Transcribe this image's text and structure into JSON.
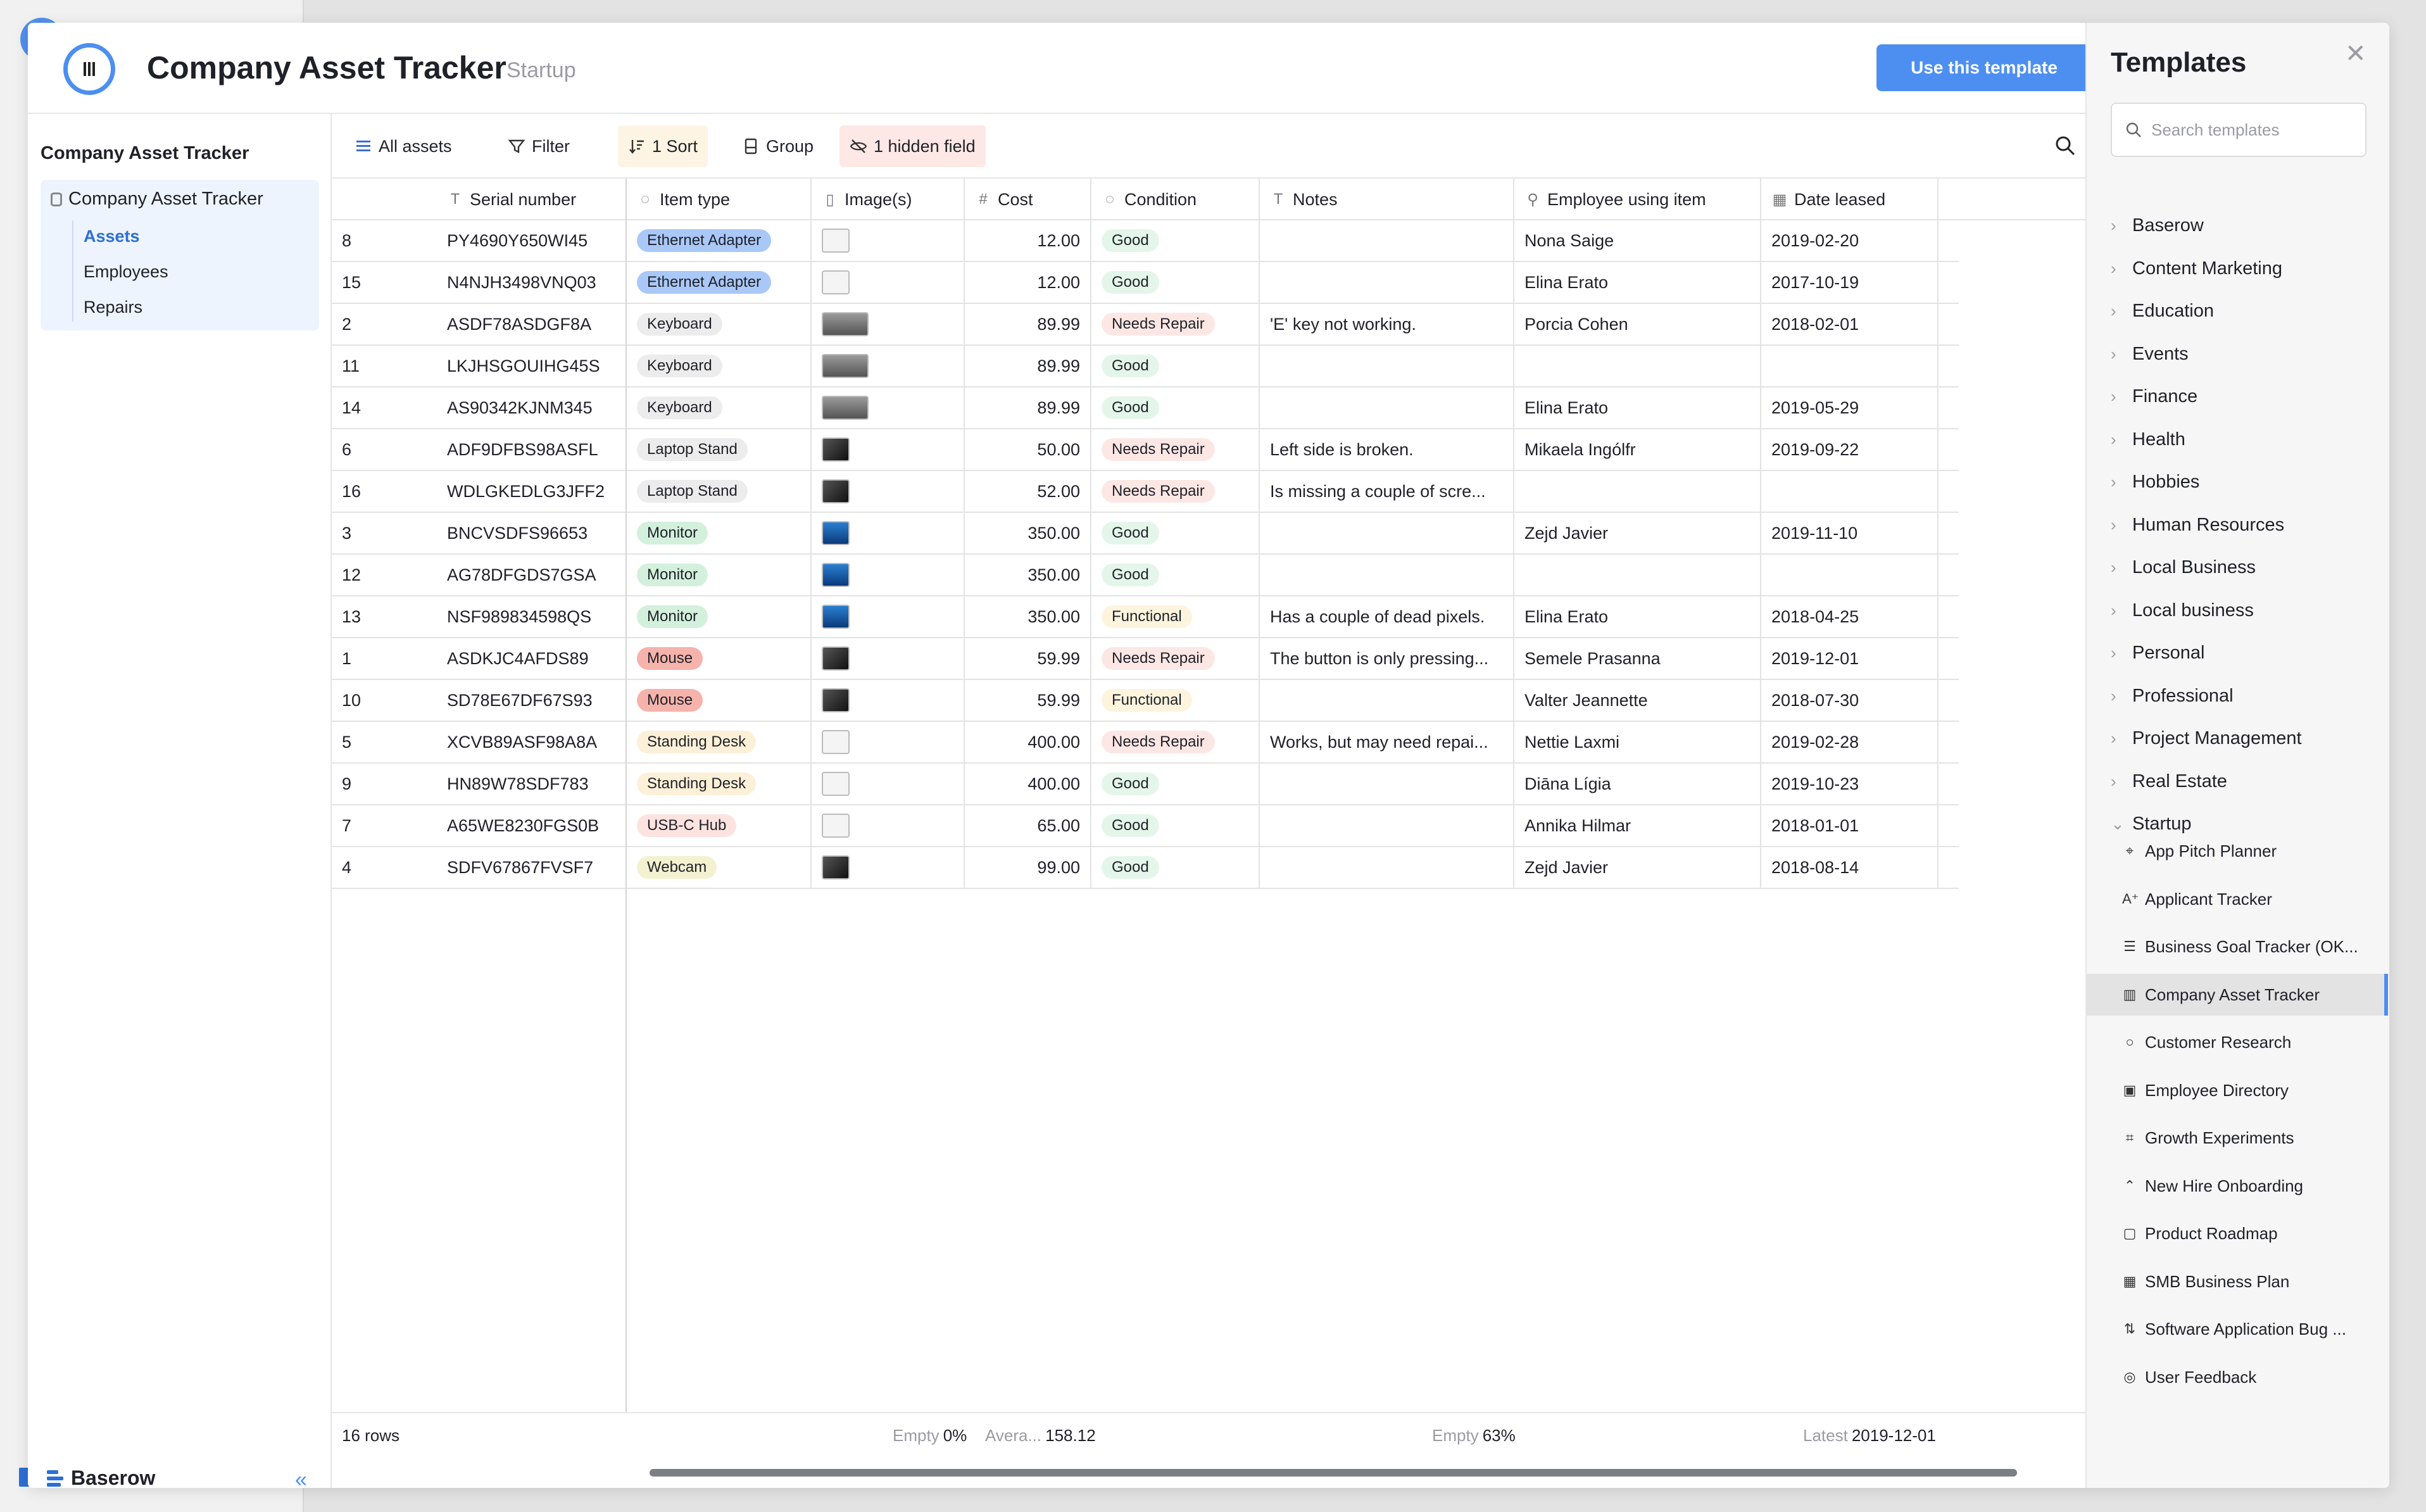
{
  "colors": {
    "accent": "#4d8ff0",
    "sort_bg": "#fdf4e3",
    "hidden_bg": "#fde8e6",
    "active_table": "#2c6fd6"
  },
  "header": {
    "title": "Company Asset Tracker",
    "category": "Startup",
    "use_button": "Use this template"
  },
  "sidebar": {
    "database_title": "Company Asset Tracker",
    "database_name": "Company Asset Tracker",
    "tables": [
      {
        "label": "Assets",
        "active": true
      },
      {
        "label": "Employees"
      },
      {
        "label": "Repairs"
      }
    ],
    "brand": "Baserow",
    "collapse_icon": "double-chevron-left-icon"
  },
  "toolbar": {
    "view": "All assets",
    "filter": "Filter",
    "sort": "1 Sort",
    "group": "Group",
    "hidden": "1 hidden field"
  },
  "columns": [
    "Serial number",
    "Item type",
    "Image(s)",
    "Cost",
    "Condition",
    "Notes",
    "Employee using item",
    "Date leased"
  ],
  "rows": [
    {
      "id": "8",
      "serial": "PY4690Y650WI45",
      "type": "Ethernet Adapter",
      "img": "light",
      "cost": "12.00",
      "cond": "Good",
      "notes": "",
      "emp": "Nona Saige",
      "date": "2019-02-20"
    },
    {
      "id": "15",
      "serial": "N4NJH3498VNQ03",
      "type": "Ethernet Adapter",
      "img": "light",
      "cost": "12.00",
      "cond": "Good",
      "notes": "",
      "emp": "Elina Erato",
      "date": "2017-10-19"
    },
    {
      "id": "2",
      "serial": "ASDF78ASDGF8A",
      "type": "Keyboard",
      "img": "wide",
      "cost": "89.99",
      "cond": "Needs Repair",
      "notes": "'E' key not working.",
      "emp": "Porcia Cohen",
      "date": "2018-02-01"
    },
    {
      "id": "11",
      "serial": "LKJHSGOUIHG45S",
      "type": "Keyboard",
      "img": "wide",
      "cost": "89.99",
      "cond": "Good",
      "notes": "",
      "emp": "",
      "date": ""
    },
    {
      "id": "14",
      "serial": "AS90342KJNM345",
      "type": "Keyboard",
      "img": "wide",
      "cost": "89.99",
      "cond": "Good",
      "notes": "",
      "emp": "Elina Erato",
      "date": "2019-05-29"
    },
    {
      "id": "6",
      "serial": "ADF9DFBS98ASFL",
      "type": "Laptop Stand",
      "img": "dark",
      "cost": "50.00",
      "cond": "Needs Repair",
      "notes": "Left side is broken.",
      "emp": "Mikaela Ingólfr",
      "date": "2019-09-22"
    },
    {
      "id": "16",
      "serial": "WDLGKEDLG3JFF2",
      "type": "Laptop Stand",
      "img": "dark",
      "cost": "52.00",
      "cond": "Needs Repair",
      "notes": "Is missing a couple of scre...",
      "emp": "",
      "date": ""
    },
    {
      "id": "3",
      "serial": "BNCVSDFS96653",
      "type": "Monitor",
      "img": "blue",
      "cost": "350.00",
      "cond": "Good",
      "notes": "",
      "emp": "Zejd Javier",
      "date": "2019-11-10"
    },
    {
      "id": "12",
      "serial": "AG78DFGDS7GSA",
      "type": "Monitor",
      "img": "blue",
      "cost": "350.00",
      "cond": "Good",
      "notes": "",
      "emp": "",
      "date": ""
    },
    {
      "id": "13",
      "serial": "NSF989834598QS",
      "type": "Monitor",
      "img": "blue",
      "cost": "350.00",
      "cond": "Functional",
      "notes": "Has a couple of dead pixels.",
      "emp": "Elina Erato",
      "date": "2018-04-25"
    },
    {
      "id": "1",
      "serial": "ASDKJC4AFDS89",
      "type": "Mouse",
      "img": "dark",
      "cost": "59.99",
      "cond": "Needs Repair",
      "notes": "The button is only pressing...",
      "emp": "Semele Prasanna",
      "date": "2019-12-01"
    },
    {
      "id": "10",
      "serial": "SD78E67DF67S93",
      "type": "Mouse",
      "img": "dark",
      "cost": "59.99",
      "cond": "Functional",
      "notes": "",
      "emp": "Valter Jeannette",
      "date": "2018-07-30"
    },
    {
      "id": "5",
      "serial": "XCVB89ASF98A8A",
      "type": "Standing Desk",
      "img": "light",
      "cost": "400.00",
      "cond": "Needs Repair",
      "notes": "Works, but may need repai...",
      "emp": "Nettie Laxmi",
      "date": "2019-02-28"
    },
    {
      "id": "9",
      "serial": "HN89W78SDF783",
      "type": "Standing Desk",
      "img": "light",
      "cost": "400.00",
      "cond": "Good",
      "notes": "",
      "emp": "Diāna Lígia",
      "date": "2019-10-23"
    },
    {
      "id": "7",
      "serial": "A65WE8230FGS0B",
      "type": "USB-C Hub",
      "img": "light",
      "cost": "65.00",
      "cond": "Good",
      "notes": "",
      "emp": "Annika Hilmar",
      "date": "2018-01-01"
    },
    {
      "id": "4",
      "serial": "SDFV67867FVSF7",
      "type": "Webcam",
      "img": "dark",
      "cost": "99.00",
      "cond": "Good",
      "notes": "",
      "emp": "Zejd Javier",
      "date": "2018-08-14"
    }
  ],
  "type_colors": {
    "Ethernet Adapter": "#a9c8f7",
    "Keyboard": "#ececec",
    "Laptop Stand": "#ececec",
    "Monitor": "#d3f0dc",
    "Mouse": "#f5b3ab",
    "Standing Desk": "#fdf0d8",
    "USB-C Hub": "#fde3e0",
    "Webcam": "#f3f1d0"
  },
  "cond_colors": {
    "Good": "#e4f6ea",
    "Needs Repair": "#fde7e5",
    "Functional": "#fdf4de"
  },
  "footer": {
    "row_count": "16 rows",
    "cost_empty_label": "Empty",
    "cost_empty_value": "0%",
    "cost_avg_label": "Avera...",
    "cost_avg_value": "158.12",
    "emp_empty_label": "Empty",
    "emp_empty_value": "63%",
    "date_latest_label": "Latest",
    "date_latest_value": "2019-12-01"
  },
  "templates_panel": {
    "title": "Templates",
    "search_placeholder": "Search templates",
    "categories": [
      "Baserow",
      "Content Marketing",
      "Education",
      "Events",
      "Finance",
      "Health",
      "Hobbies",
      "Human Resources",
      "Local Business",
      "Local business",
      "Personal",
      "Professional",
      "Project Management",
      "Real Estate"
    ],
    "expanded_category": "Startup",
    "startup_templates": [
      {
        "label": "App Pitch Planner",
        "icon": "map-pin-icon"
      },
      {
        "label": "Applicant Tracker",
        "icon": "user-add-icon"
      },
      {
        "label": "Business Goal Tracker (OK...",
        "icon": "list-icon"
      },
      {
        "label": "Company Asset Tracker",
        "icon": "barcode-icon",
        "active": true
      },
      {
        "label": "Customer Research",
        "icon": "search-icon"
      },
      {
        "label": "Employee Directory",
        "icon": "id-card-icon"
      },
      {
        "label": "Growth Experiments",
        "icon": "scan-icon"
      },
      {
        "label": "New Hire Onboarding",
        "icon": "signal-icon"
      },
      {
        "label": "Product Roadmap",
        "icon": "chat-icon"
      },
      {
        "label": "SMB Business Plan",
        "icon": "calendar-icon"
      },
      {
        "label": "Software Application Bug ...",
        "icon": "sort-icon"
      },
      {
        "label": "User Feedback",
        "icon": "feedback-icon"
      }
    ]
  }
}
